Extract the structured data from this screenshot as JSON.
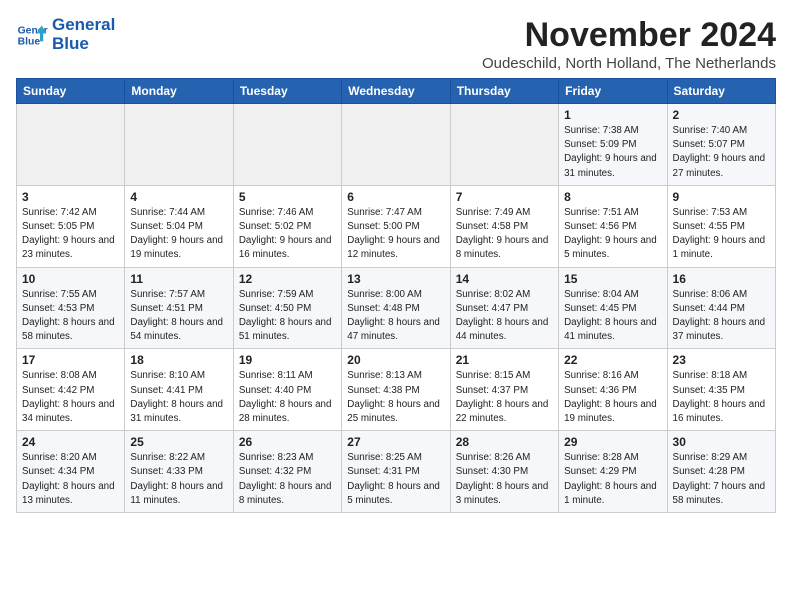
{
  "header": {
    "logo_line1": "General",
    "logo_line2": "Blue",
    "month_title": "November 2024",
    "location": "Oudeschild, North Holland, The Netherlands"
  },
  "weekdays": [
    "Sunday",
    "Monday",
    "Tuesday",
    "Wednesday",
    "Thursday",
    "Friday",
    "Saturday"
  ],
  "weeks": [
    [
      {
        "day": "",
        "info": ""
      },
      {
        "day": "",
        "info": ""
      },
      {
        "day": "",
        "info": ""
      },
      {
        "day": "",
        "info": ""
      },
      {
        "day": "",
        "info": ""
      },
      {
        "day": "1",
        "info": "Sunrise: 7:38 AM\nSunset: 5:09 PM\nDaylight: 9 hours and 31 minutes."
      },
      {
        "day": "2",
        "info": "Sunrise: 7:40 AM\nSunset: 5:07 PM\nDaylight: 9 hours and 27 minutes."
      }
    ],
    [
      {
        "day": "3",
        "info": "Sunrise: 7:42 AM\nSunset: 5:05 PM\nDaylight: 9 hours and 23 minutes."
      },
      {
        "day": "4",
        "info": "Sunrise: 7:44 AM\nSunset: 5:04 PM\nDaylight: 9 hours and 19 minutes."
      },
      {
        "day": "5",
        "info": "Sunrise: 7:46 AM\nSunset: 5:02 PM\nDaylight: 9 hours and 16 minutes."
      },
      {
        "day": "6",
        "info": "Sunrise: 7:47 AM\nSunset: 5:00 PM\nDaylight: 9 hours and 12 minutes."
      },
      {
        "day": "7",
        "info": "Sunrise: 7:49 AM\nSunset: 4:58 PM\nDaylight: 9 hours and 8 minutes."
      },
      {
        "day": "8",
        "info": "Sunrise: 7:51 AM\nSunset: 4:56 PM\nDaylight: 9 hours and 5 minutes."
      },
      {
        "day": "9",
        "info": "Sunrise: 7:53 AM\nSunset: 4:55 PM\nDaylight: 9 hours and 1 minute."
      }
    ],
    [
      {
        "day": "10",
        "info": "Sunrise: 7:55 AM\nSunset: 4:53 PM\nDaylight: 8 hours and 58 minutes."
      },
      {
        "day": "11",
        "info": "Sunrise: 7:57 AM\nSunset: 4:51 PM\nDaylight: 8 hours and 54 minutes."
      },
      {
        "day": "12",
        "info": "Sunrise: 7:59 AM\nSunset: 4:50 PM\nDaylight: 8 hours and 51 minutes."
      },
      {
        "day": "13",
        "info": "Sunrise: 8:00 AM\nSunset: 4:48 PM\nDaylight: 8 hours and 47 minutes."
      },
      {
        "day": "14",
        "info": "Sunrise: 8:02 AM\nSunset: 4:47 PM\nDaylight: 8 hours and 44 minutes."
      },
      {
        "day": "15",
        "info": "Sunrise: 8:04 AM\nSunset: 4:45 PM\nDaylight: 8 hours and 41 minutes."
      },
      {
        "day": "16",
        "info": "Sunrise: 8:06 AM\nSunset: 4:44 PM\nDaylight: 8 hours and 37 minutes."
      }
    ],
    [
      {
        "day": "17",
        "info": "Sunrise: 8:08 AM\nSunset: 4:42 PM\nDaylight: 8 hours and 34 minutes."
      },
      {
        "day": "18",
        "info": "Sunrise: 8:10 AM\nSunset: 4:41 PM\nDaylight: 8 hours and 31 minutes."
      },
      {
        "day": "19",
        "info": "Sunrise: 8:11 AM\nSunset: 4:40 PM\nDaylight: 8 hours and 28 minutes."
      },
      {
        "day": "20",
        "info": "Sunrise: 8:13 AM\nSunset: 4:38 PM\nDaylight: 8 hours and 25 minutes."
      },
      {
        "day": "21",
        "info": "Sunrise: 8:15 AM\nSunset: 4:37 PM\nDaylight: 8 hours and 22 minutes."
      },
      {
        "day": "22",
        "info": "Sunrise: 8:16 AM\nSunset: 4:36 PM\nDaylight: 8 hours and 19 minutes."
      },
      {
        "day": "23",
        "info": "Sunrise: 8:18 AM\nSunset: 4:35 PM\nDaylight: 8 hours and 16 minutes."
      }
    ],
    [
      {
        "day": "24",
        "info": "Sunrise: 8:20 AM\nSunset: 4:34 PM\nDaylight: 8 hours and 13 minutes."
      },
      {
        "day": "25",
        "info": "Sunrise: 8:22 AM\nSunset: 4:33 PM\nDaylight: 8 hours and 11 minutes."
      },
      {
        "day": "26",
        "info": "Sunrise: 8:23 AM\nSunset: 4:32 PM\nDaylight: 8 hours and 8 minutes."
      },
      {
        "day": "27",
        "info": "Sunrise: 8:25 AM\nSunset: 4:31 PM\nDaylight: 8 hours and 5 minutes."
      },
      {
        "day": "28",
        "info": "Sunrise: 8:26 AM\nSunset: 4:30 PM\nDaylight: 8 hours and 3 minutes."
      },
      {
        "day": "29",
        "info": "Sunrise: 8:28 AM\nSunset: 4:29 PM\nDaylight: 8 hours and 1 minute."
      },
      {
        "day": "30",
        "info": "Sunrise: 8:29 AM\nSunset: 4:28 PM\nDaylight: 7 hours and 58 minutes."
      }
    ]
  ]
}
